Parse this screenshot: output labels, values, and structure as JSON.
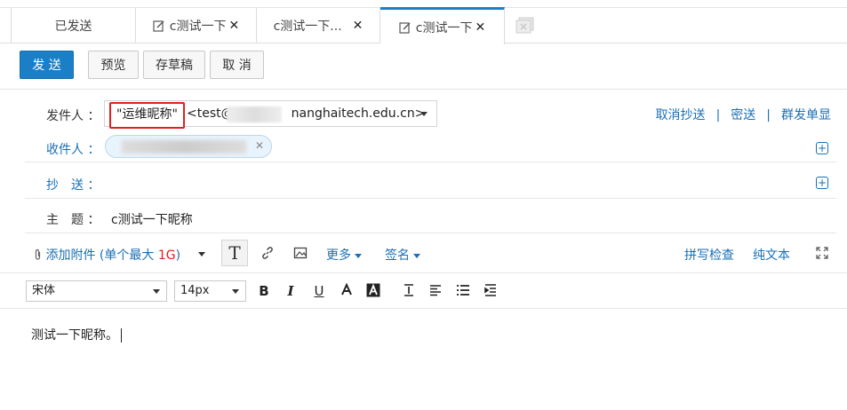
{
  "tabs": [
    {
      "label": "已发送",
      "active": false,
      "closable": false
    },
    {
      "label": "c测试一下",
      "active": false,
      "closable": true,
      "icon": "edit-icon"
    },
    {
      "label": "c测试一下...",
      "active": false,
      "closable": true
    },
    {
      "label": "c测试一下",
      "active": true,
      "closable": true,
      "icon": "edit-icon"
    }
  ],
  "toolbar": {
    "send": "发 送",
    "preview": "预览",
    "draft": "存草稿",
    "cancel": "取 消"
  },
  "header": {
    "from_label": "发件人 ：",
    "sender_nickname": "\"运维昵称\"",
    "sender_email_prefix": "<test@",
    "sender_email_suffix": "nanghaitech.edu.cn>",
    "to_label": "收件人 ：",
    "cc_label": "抄　送 ：",
    "subject_label": "主　题 ：",
    "subject_value": "c测试一下昵称",
    "links": {
      "cancel_cc": "取消抄送",
      "bcc": "密送",
      "separate": "群发单显",
      "sep": "|"
    }
  },
  "editor_toolbar": {
    "attach": "添加附件 (单个最大 ",
    "attach_limit": "1G",
    "attach_close": ")",
    "more": "更多",
    "signature": "签名",
    "spellcheck": "拼写检查",
    "plaintext": "纯文本",
    "font_icon": "T"
  },
  "format": {
    "font_family": "宋体",
    "font_size": "14px"
  },
  "body": {
    "text": "测试一下昵称。"
  },
  "colors": {
    "accent": "#1a7fc7",
    "link": "#1a6fb5",
    "highlight": "#e02020"
  }
}
